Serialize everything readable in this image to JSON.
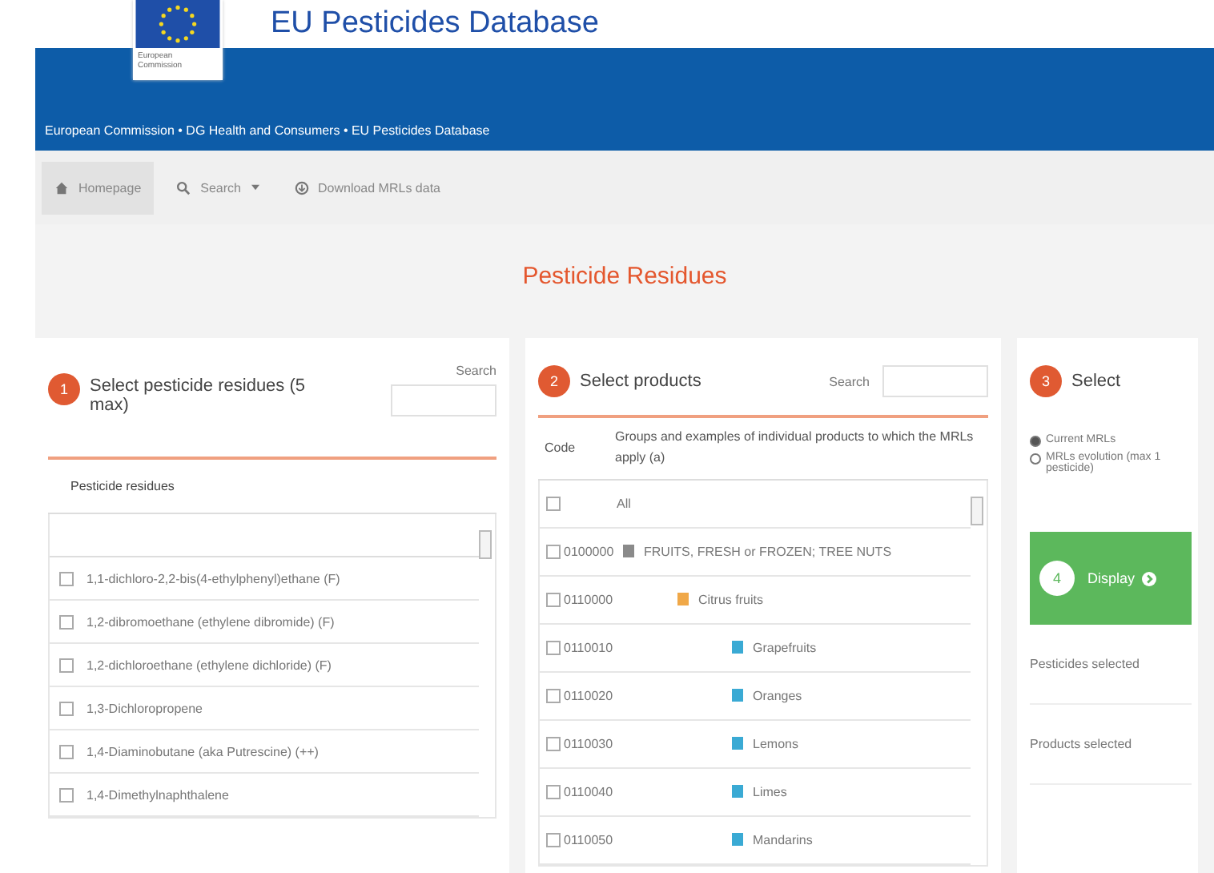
{
  "header": {
    "logo_caption": "European Commission",
    "title": "EU Pesticides Database",
    "breadcrumb": "European Commission • DG Health and Consumers • EU Pesticides Database"
  },
  "nav": [
    {
      "label": "Homepage",
      "kind": "home",
      "selected": true,
      "dropdown": false
    },
    {
      "label": "Search",
      "kind": "search",
      "selected": false,
      "dropdown": true
    },
    {
      "label": "Download MRLs data",
      "kind": "download",
      "selected": false,
      "dropdown": false
    }
  ],
  "page_title": "Pesticide Residues",
  "residues_panel": {
    "step": "1",
    "title": "Select pesticide residues (5 max)",
    "search_label": "Search",
    "column": "Pesticide residues",
    "items": [
      {
        "label": "1,1-dichloro-2,2-bis(4-ethylphenyl)ethane (F)",
        "checked": false
      },
      {
        "label": "1,2-dibromoethane (ethylene dibromide) (F)",
        "checked": false
      },
      {
        "label": "1,2-dichloroethane (ethylene dichloride) (F)",
        "checked": false
      },
      {
        "label": "1,3-Dichloropropene",
        "checked": false
      },
      {
        "label": "1,4-Diaminobutane (aka Putrescine) (++)",
        "checked": false
      },
      {
        "label": "1,4-Dimethylnaphthalene",
        "checked": false
      }
    ]
  },
  "products_panel": {
    "step": "2",
    "title": "Select products",
    "search_label": "Search",
    "columns": [
      "Code",
      "Groups and examples of individual products to which the MRLs apply (a)"
    ],
    "all": {
      "label": "All",
      "checked": false
    },
    "tree": [
      {
        "code": "0100000",
        "label": "FRUITS, FRESH or FROZEN; TREE NUTS",
        "checked": false,
        "color": "#8a8a8a",
        "children": [
          {
            "code": "0110000",
            "label": "Citrus fruits",
            "checked": false,
            "color": "#f0a848",
            "children": [
              {
                "code": "0110010",
                "label": "Grapefruits",
                "checked": false,
                "color": "#3aaad4"
              },
              {
                "code": "0110020",
                "label": "Oranges",
                "checked": false,
                "color": "#3aaad4"
              },
              {
                "code": "0110030",
                "label": "Lemons",
                "checked": false,
                "color": "#3aaad4"
              },
              {
                "code": "0110040",
                "label": "Limes",
                "checked": false,
                "color": "#3aaad4"
              },
              {
                "code": "0110050",
                "label": "Mandarins",
                "checked": false,
                "color": "#3aaad4"
              }
            ]
          }
        ]
      }
    ]
  },
  "select_panel": {
    "step": "3",
    "title": "Select",
    "options": [
      {
        "label": "Current MRLs",
        "selected": true
      },
      {
        "label": "MRLs evolution (max 1 pesticide)",
        "selected": false
      }
    ],
    "display_button": {
      "step": "4",
      "label": "Display"
    },
    "summaries": [
      "Pesticides selected",
      "Products selected"
    ]
  }
}
